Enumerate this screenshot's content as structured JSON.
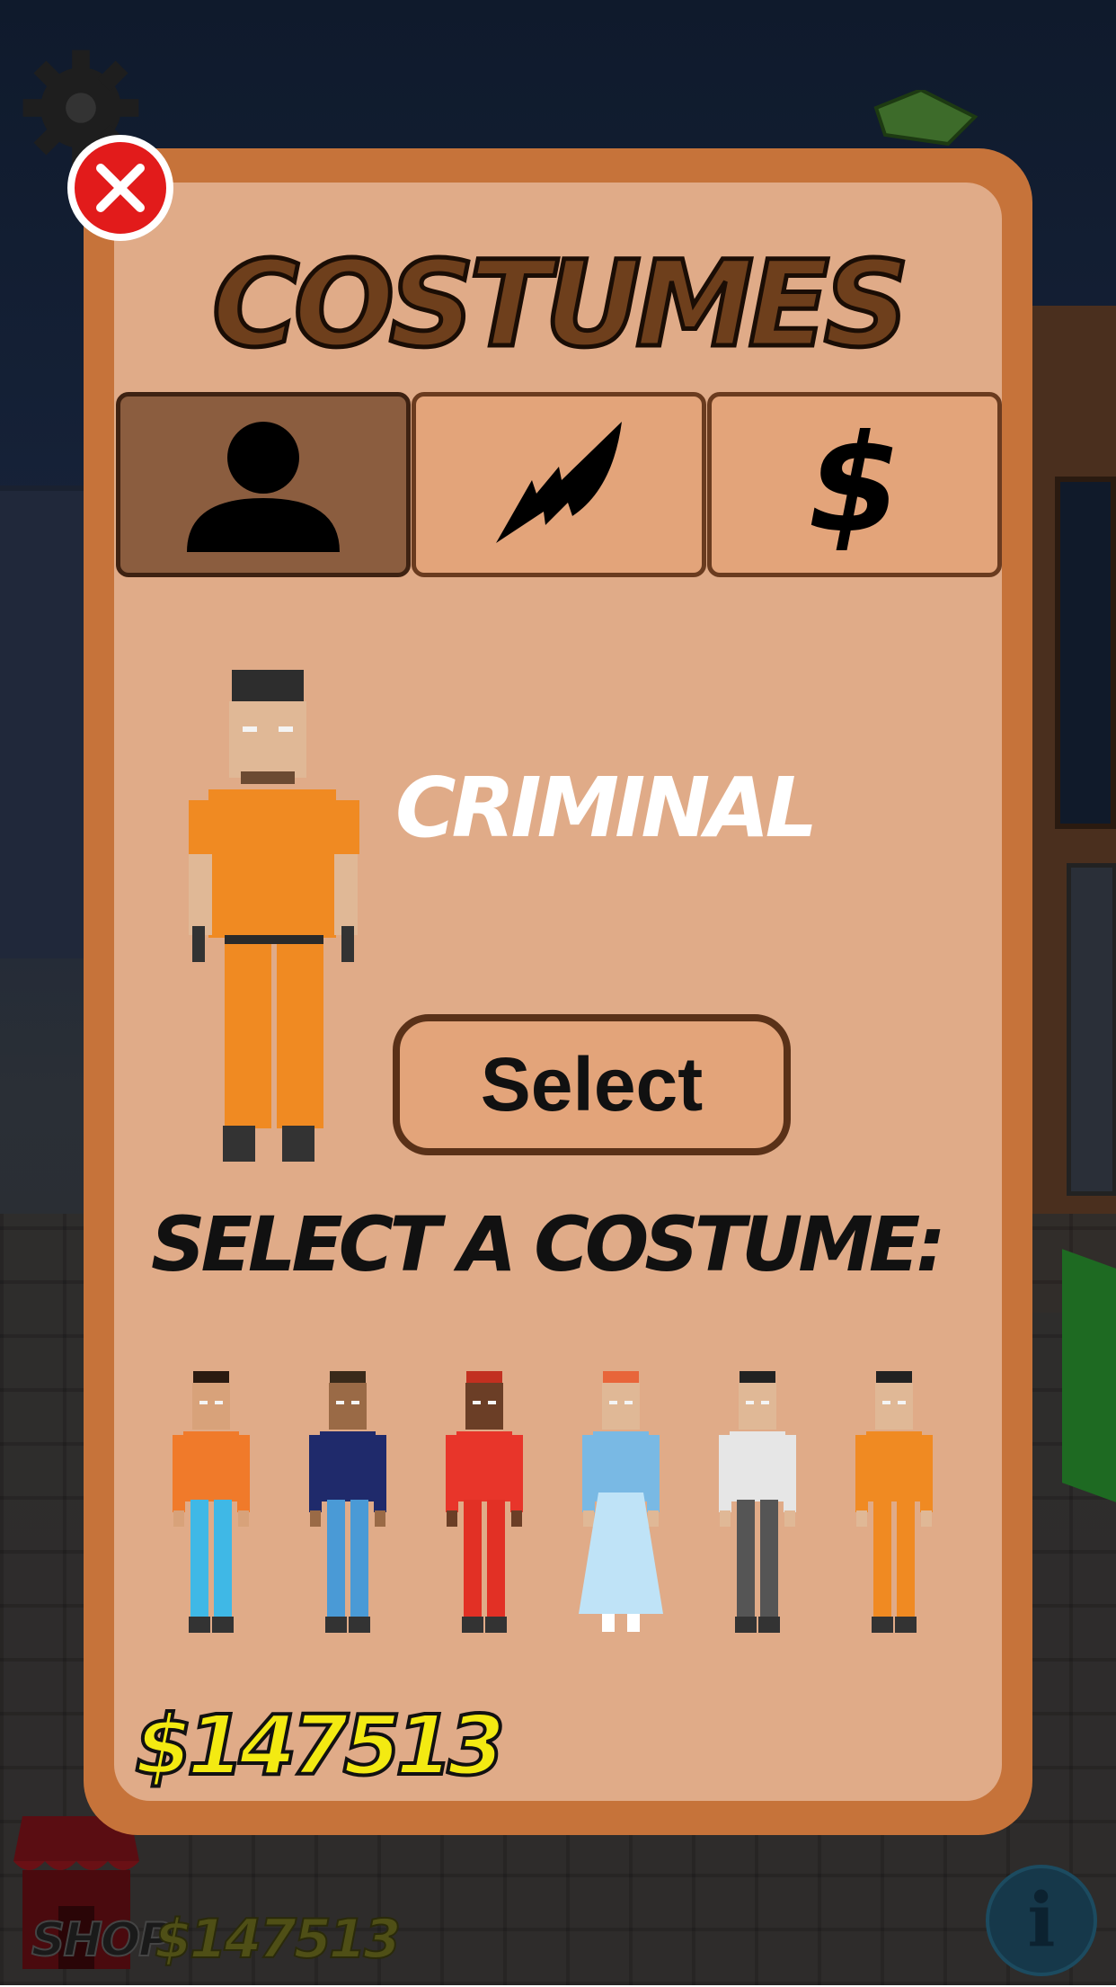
{
  "screen": {
    "title": "COSTUMES"
  },
  "tabs": [
    {
      "icon": "person-icon",
      "active": true
    },
    {
      "icon": "rocket-icon",
      "active": false
    },
    {
      "icon": "dollar-icon",
      "label": "$",
      "active": false
    }
  ],
  "preview": {
    "costume_name": "CRIMINAL",
    "select_label": "Select"
  },
  "costume_list": {
    "heading": "SELECT A COSTUME:",
    "items": [
      {
        "icon": "costume-orange-shirt-icon",
        "shirt": "#f07a2a",
        "pants": "#3fb8e6",
        "hair": "#2a1a10",
        "skin": "#d8a27a"
      },
      {
        "icon": "costume-navy-sweater-icon",
        "shirt": "#1f2a6b",
        "pants": "#4a9ad6",
        "hair": "#3a2a1a",
        "skin": "#9a6a46"
      },
      {
        "icon": "costume-firefighter-icon",
        "shirt": "#e8352a",
        "pants": "#e23025",
        "hair": "#c23020",
        "skin": "#6b3e26"
      },
      {
        "icon": "costume-blue-dress-icon",
        "shirt": "#79b9e4",
        "pants": "#bfe3f7",
        "hair": "#e8653a",
        "skin": "#e0b896"
      },
      {
        "icon": "costume-scientist-icon",
        "shirt": "#e6e6e6",
        "pants": "#555555",
        "hair": "#222222",
        "skin": "#e0b896"
      },
      {
        "icon": "costume-criminal-icon",
        "shirt": "#f08a22",
        "pants": "#f08a22",
        "hair": "#222222",
        "skin": "#e0b896"
      }
    ]
  },
  "wallet": {
    "money": "$147513"
  },
  "hud": {
    "shop_label": "SHOP",
    "money": "$147513"
  },
  "colors": {
    "panel_outer": "#c6733a",
    "panel_inner": "#e0ab88",
    "title": "#6e3f1c",
    "money": "#f3ea12",
    "close": "#e21b1b"
  }
}
